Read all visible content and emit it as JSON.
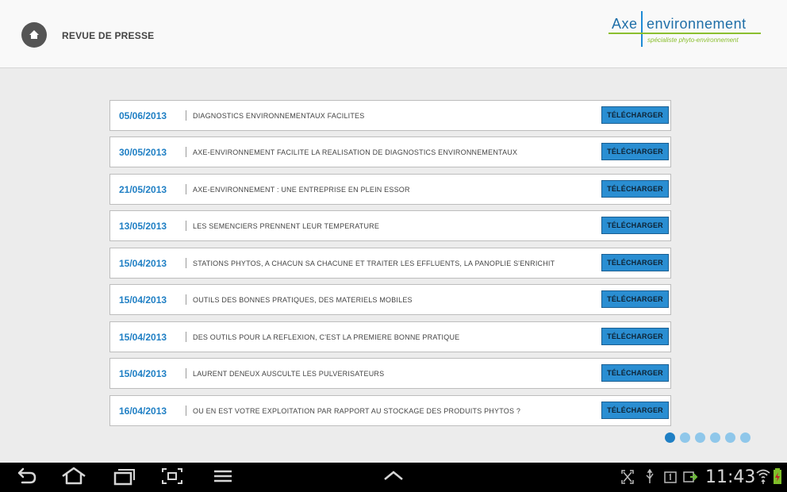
{
  "header": {
    "title": "REVUE DE PRESSE",
    "logo": {
      "axe": "Axe",
      "environnement": "environnement",
      "tagline": "spécialiste phyto-environnement"
    }
  },
  "items": [
    {
      "date": "05/06/2013",
      "title": "DIAGNOSTICS ENVIRONNEMENTAUX FACILITES",
      "button": "TÉLÉCHARGER"
    },
    {
      "date": "30/05/2013",
      "title": "AXE-ENVIRONNEMENT FACILITE LA REALISATION DE DIAGNOSTICS ENVIRONNEMENTAUX",
      "button": "TÉLÉCHARGER"
    },
    {
      "date": "21/05/2013",
      "title": "AXE-ENVIRONNEMENT : UNE ENTREPRISE EN PLEIN ESSOR",
      "button": "TÉLÉCHARGER"
    },
    {
      "date": "13/05/2013",
      "title": "LES SEMENCIERS PRENNENT LEUR TEMPERATURE",
      "button": "TÉLÉCHARGER"
    },
    {
      "date": "15/04/2013",
      "title": "STATIONS PHYTOS, A CHACUN SA CHACUNE ET TRAITER LES EFFLUENTS, LA PANOPLIE S'ENRICHIT",
      "button": "TÉLÉCHARGER"
    },
    {
      "date": "15/04/2013",
      "title": "OUTILS DES BONNES PRATIQUES, DES MATERIELS MOBILES",
      "button": "TÉLÉCHARGER"
    },
    {
      "date": "15/04/2013",
      "title": "DES OUTILS POUR LA REFLEXION, C'EST LA PREMIERE BONNE PRATIQUE",
      "button": "TÉLÉCHARGER"
    },
    {
      "date": "15/04/2013",
      "title": "LAURENT DENEUX AUSCULTE LES PULVERISATEURS",
      "button": "TÉLÉCHARGER"
    },
    {
      "date": "16/04/2013",
      "title": "OU EN EST VOTRE EXPLOITATION PAR RAPPORT AU STOCKAGE DES PRODUITS PHYTOS ?",
      "button": "TÉLÉCHARGER"
    }
  ],
  "pagination": {
    "pages": 6,
    "current": 1
  },
  "status_bar": {
    "time": "11:43"
  },
  "colors": {
    "accent": "#1f7fc4",
    "button": "#2a8ed2",
    "logo_green": "#8bbf2f"
  },
  "icons": {
    "home": "home-icon",
    "nav": [
      "back-icon",
      "home-nav-icon",
      "recent-apps-icon",
      "screenshot-icon",
      "menu-icon",
      "expand-up-icon"
    ],
    "status": [
      "fullscreen-icon",
      "usb-icon",
      "notification-icon",
      "sync-icon",
      "wifi-icon",
      "battery-icon"
    ]
  }
}
